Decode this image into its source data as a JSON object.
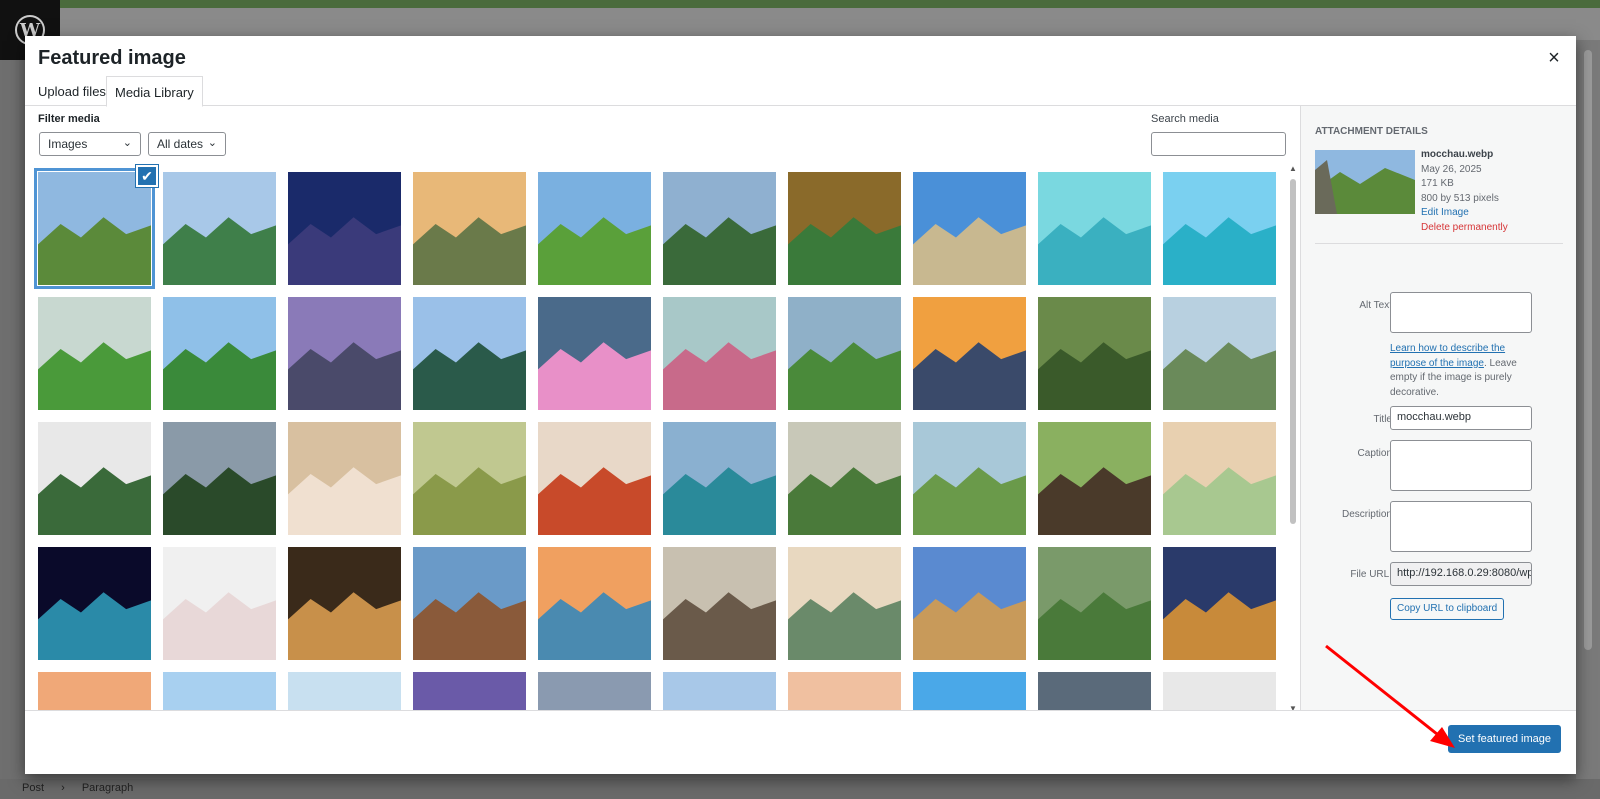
{
  "editor": {
    "footer_crumbs": [
      "Post",
      "Paragraph"
    ]
  },
  "modal": {
    "title": "Featured image",
    "close_symbol": "×",
    "tabs": [
      "Upload files",
      "Media Library"
    ],
    "active_tab": "Media Library",
    "filter_label": "Filter media",
    "type_filter": "Images",
    "date_filter": "All dates",
    "search_label": "Search media",
    "search_value": ""
  },
  "grid": {
    "selected_index": 0,
    "colors": [
      [
        "#8fb8e0",
        "#5b8a3a"
      ],
      [
        "#a8c8e8",
        "#3f7f4a"
      ],
      [
        "#1a2a6a",
        "#3a3a7a"
      ],
      [
        "#e8b878",
        "#6a7a4a"
      ],
      [
        "#7ab0e0",
        "#5aa03a"
      ],
      [
        "#8fb0d0",
        "#3a6a3a"
      ],
      [
        "#8a6a2a",
        "#3a7a3a"
      ],
      [
        "#4a90d8",
        "#c8b890"
      ],
      [
        "#7ad8e0",
        "#3ab0c0"
      ],
      [
        "#7ad0f0",
        "#2ab0c8"
      ],
      [
        "#c8d8d0",
        "#4a9a3a"
      ],
      [
        "#8fc0e8",
        "#3a8a3a"
      ],
      [
        "#8a7ab8",
        "#4a4a6a"
      ],
      [
        "#9ac0e8",
        "#2a5a4a"
      ],
      [
        "#4a6a8a",
        "#e890c8"
      ],
      [
        "#a8c8c8",
        "#c86a8a"
      ],
      [
        "#8fb0c8",
        "#4a8a3a"
      ],
      [
        "#f0a040",
        "#3a4a6a"
      ],
      [
        "#6a8a4a",
        "#3a5a2a"
      ],
      [
        "#b8d0e0",
        "#6a8a5a"
      ],
      [
        "#e8e8e8",
        "#3a6a3a"
      ],
      [
        "#8a9aa8",
        "#2a4a2a"
      ],
      [
        "#d8c0a0",
        "#f0e0d0"
      ],
      [
        "#c0c890",
        "#8a9a4a"
      ],
      [
        "#e8d8c8",
        "#c84a2a"
      ],
      [
        "#8ab0d0",
        "#2a8a9a"
      ],
      [
        "#c8c8b8",
        "#4a7a3a"
      ],
      [
        "#a8c8d8",
        "#6a9a4a"
      ],
      [
        "#8ab060",
        "#4a3a2a"
      ],
      [
        "#e8d0b0",
        "#a8c890"
      ],
      [
        "#0a0a2a",
        "#2a8aa8"
      ],
      [
        "#f0f0f0",
        "#e8d8d8"
      ],
      [
        "#3a2a1a",
        "#c8904a"
      ],
      [
        "#6a9ac8",
        "#8a5a3a"
      ],
      [
        "#f0a060",
        "#4a8ab0"
      ],
      [
        "#c8c0b0",
        "#6a5a4a"
      ],
      [
        "#e8d8c0",
        "#6a8a6a"
      ],
      [
        "#5a8ad0",
        "#c89a5a"
      ],
      [
        "#7a9a6a",
        "#4a7a3a"
      ],
      [
        "#2a3a6a",
        "#c88a3a"
      ],
      [
        "#f0a878",
        "#c88a6a"
      ],
      [
        "#a8d0f0",
        "#e0e8f0"
      ],
      [
        "#c8e0f0",
        "#e8f0f8"
      ],
      [
        "#6a5aa8",
        "#f0a040"
      ],
      [
        "#8a9ab0",
        "#6a7a8a"
      ],
      [
        "#a8c8e8",
        "#c8c0b0"
      ],
      [
        "#f0c0a0",
        "#e8a888"
      ],
      [
        "#4aa8e8",
        "#2a8ad0"
      ],
      [
        "#5a6a7a",
        "#8aa0c0"
      ],
      [
        "#e8e8e8",
        "#6a7a8a"
      ]
    ]
  },
  "attachment": {
    "heading": "Attachment details",
    "filename": "mocchau.webp",
    "date": "May 26, 2025",
    "size": "171 KB",
    "dimensions": "800 by 513 pixels",
    "edit_link": "Edit Image",
    "delete_link": "Delete permanently",
    "alt_label": "Alt Text",
    "alt_value": "",
    "alt_help_link": "Learn how to describe the purpose of the image",
    "alt_help_text": ". Leave empty if the image is purely decorative.",
    "title_label": "Title",
    "title_value": "mocchau.webp",
    "caption_label": "Caption",
    "caption_value": "",
    "description_label": "Description",
    "description_value": "",
    "url_label": "File URL:",
    "url_value": "http://192.168.0.29:8080/wp",
    "copy_button": "Copy URL to clipboard"
  },
  "footer": {
    "primary_button": "Set featured image"
  }
}
